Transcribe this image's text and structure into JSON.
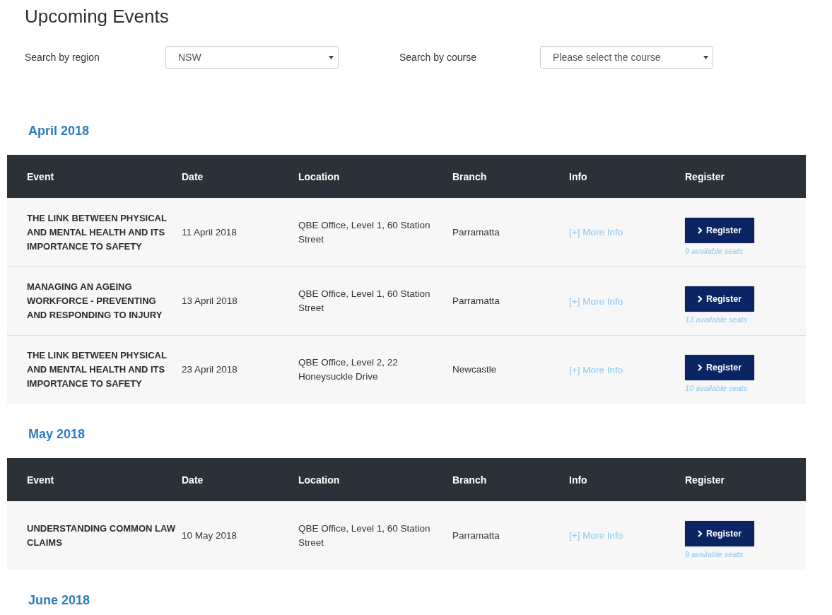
{
  "title": "Upcoming Events",
  "filters": [
    {
      "label": "Search by region",
      "value": "NSW"
    },
    {
      "label": "Search by course",
      "value": "Please select the course"
    }
  ],
  "months": [
    {
      "heading": "April 2018",
      "columns": [
        "Event",
        "Date",
        "Location",
        "Branch",
        "Info",
        "Register"
      ],
      "rows": [
        {
          "event": "THE LINK BETWEEN PHYSICAL AND MENTAL HEALTH AND ITS IMPORTANCE TO SAFETY",
          "date": "11 April 2018",
          "location": "QBE Office, Level 1, 60 Station Street",
          "branch": "Parramatta",
          "info": "[+] More Info",
          "button": "Register",
          "seats": "9 available seats"
        },
        {
          "event": "MANAGING AN AGEING WORKFORCE - PREVENTING AND RESPONDING TO INJURY",
          "date": "13 April 2018",
          "location": "QBE Office, Level 1, 60 Station Street",
          "branch": "Parramatta",
          "info": "[+] More Info",
          "button": "Register",
          "seats": "13 available seats"
        },
        {
          "event": "THE LINK BETWEEN PHYSICAL AND MENTAL HEALTH AND ITS IMPORTANCE TO SAFETY",
          "date": "23 April 2018",
          "location": "QBE Office, Level 2, 22 Honeysuckle Drive",
          "branch": "Newcastle",
          "info": "[+] More Info",
          "button": "Register",
          "seats": "10 available seats"
        }
      ]
    },
    {
      "heading": "May 2018",
      "columns": [
        "Event",
        "Date",
        "Location",
        "Branch",
        "Info",
        "Register"
      ],
      "rows": [
        {
          "event": "UNDERSTANDING COMMON LAW CLAIMS",
          "date": "10 May 2018",
          "location": "QBE Office, Level 1, 60 Station Street",
          "branch": "Parramatta",
          "info": "[+] More Info",
          "button": "Register",
          "seats": "9 available seats"
        }
      ]
    },
    {
      "heading": "June 2018"
    }
  ]
}
